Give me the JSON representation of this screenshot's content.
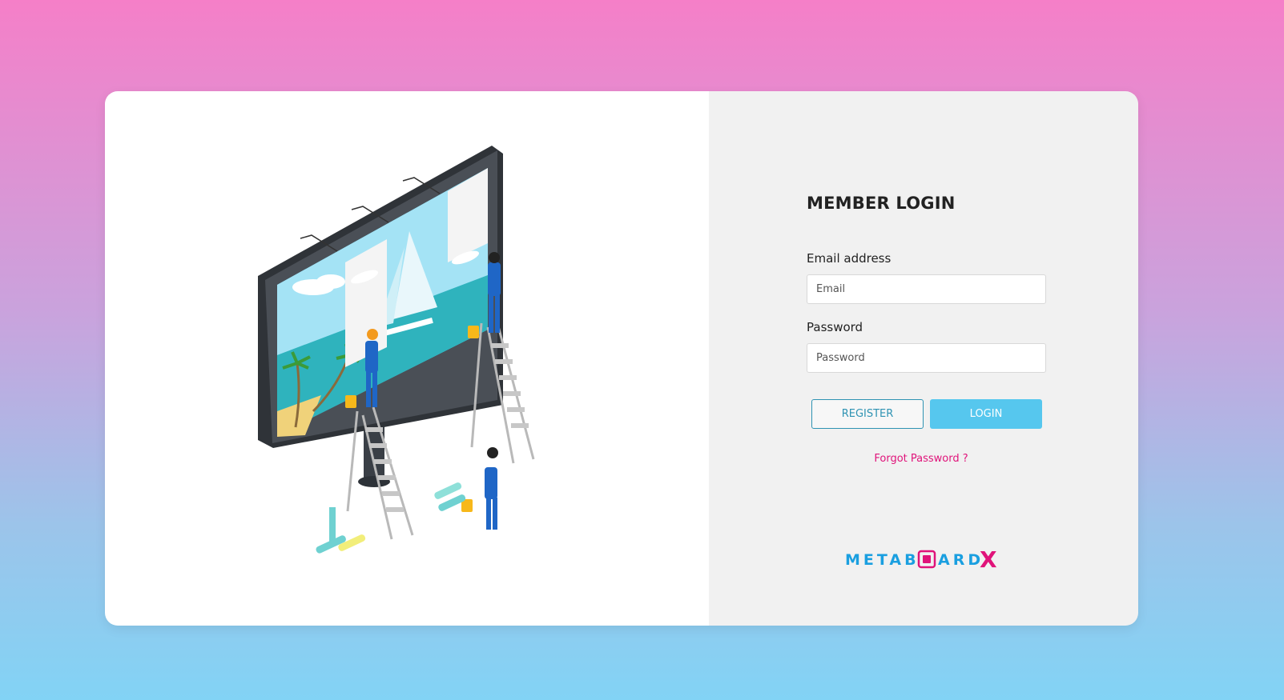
{
  "login": {
    "title": "MEMBER LOGIN",
    "email_label": "Email address",
    "email_placeholder": "Email",
    "email_value": "",
    "password_label": "Password",
    "password_placeholder": "Password",
    "password_value": "",
    "register_label": "REGISTER",
    "login_label": "LOGIN",
    "forgot_label": "Forgot Password ?"
  },
  "brand": {
    "logo_text": "METABOARDX",
    "primary_color": "#1a9fe0",
    "accent_color": "#e0137a"
  },
  "colors": {
    "login_button": "#56c7ee",
    "register_border": "#2f93b3",
    "link": "#e0137a"
  },
  "illustration": {
    "icon": "billboard-workers-illustration"
  }
}
